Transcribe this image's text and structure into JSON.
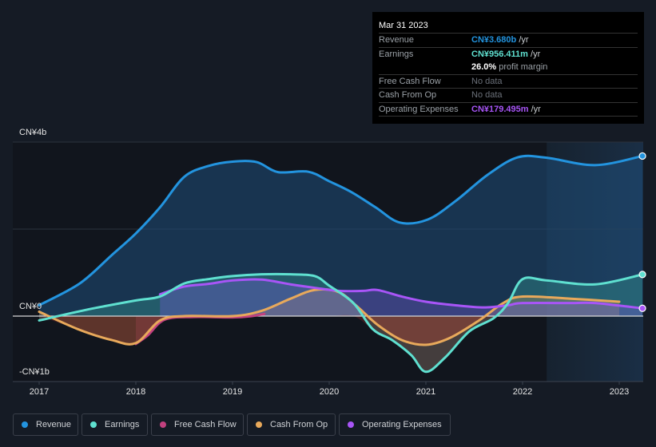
{
  "tooltip": {
    "date": "Mar 31 2023",
    "rows": [
      {
        "label": "Revenue",
        "value": "CN¥3.680b",
        "unit": " /yr",
        "color": "#2394df"
      },
      {
        "label": "Earnings",
        "value": "CN¥956.411m",
        "unit": " /yr",
        "color": "#5fe0d0"
      },
      {
        "label": "",
        "value": "26.0%",
        "unit": " profit margin",
        "color": "#ffffff"
      },
      {
        "label": "Free Cash Flow",
        "value": "No data",
        "unit": "",
        "color": "#6b7079"
      },
      {
        "label": "Cash From Op",
        "value": "No data",
        "unit": "",
        "color": "#6b7079"
      },
      {
        "label": "Operating Expenses",
        "value": "CN¥179.495m",
        "unit": " /yr",
        "color": "#a855f7"
      }
    ]
  },
  "legend": [
    {
      "label": "Revenue",
      "color": "#2394df"
    },
    {
      "label": "Earnings",
      "color": "#5fe0d0"
    },
    {
      "label": "Free Cash Flow",
      "color": "#c2417f"
    },
    {
      "label": "Cash From Op",
      "color": "#e8a95b"
    },
    {
      "label": "Operating Expenses",
      "color": "#a855f7"
    }
  ],
  "chart_data": {
    "type": "line",
    "title": "",
    "xlabel": "",
    "ylabel": "",
    "y_tick_labels": [
      "CN¥4b",
      "CN¥0",
      "-CN¥1b"
    ],
    "y_ticks": [
      4,
      0,
      -1
    ],
    "x_ticks": [
      2017,
      2018,
      2019,
      2020,
      2021,
      2022,
      2023
    ],
    "x_tick_labels": [
      "2017",
      "2018",
      "2019",
      "2020",
      "2021",
      "2022",
      "2023"
    ],
    "xlim": [
      2016.74,
      2023.25
    ],
    "ylim": [
      -1.5,
      4
    ],
    "units": "CN¥ billions",
    "highlight_from": 2022.25,
    "grid": true,
    "legend_position": "bottom",
    "series": [
      {
        "name": "Revenue",
        "color": "#2394df",
        "x": [
          2017.0,
          2017.42,
          2017.75,
          2018.0,
          2018.25,
          2018.5,
          2018.75,
          2019.0,
          2019.25,
          2019.47,
          2019.78,
          2020.0,
          2020.23,
          2020.48,
          2020.73,
          2021.02,
          2021.31,
          2021.64,
          2021.95,
          2022.25,
          2022.75,
          2023.24
        ],
        "y": [
          0.25,
          0.75,
          1.4,
          1.9,
          2.5,
          3.2,
          3.45,
          3.55,
          3.54,
          3.31,
          3.32,
          3.1,
          2.85,
          2.5,
          2.15,
          2.22,
          2.65,
          3.25,
          3.65,
          3.64,
          3.47,
          3.68
        ]
      },
      {
        "name": "Earnings",
        "color": "#5fe0d0",
        "x": [
          2017.0,
          2017.5,
          2018.0,
          2018.25,
          2018.5,
          2018.75,
          2019.0,
          2019.3,
          2019.6,
          2019.85,
          2020.0,
          2020.25,
          2020.45,
          2020.65,
          2020.85,
          2021.0,
          2021.2,
          2021.45,
          2021.7,
          2021.85,
          2022.0,
          2022.25,
          2022.75,
          2023.24
        ],
        "y": [
          -0.1,
          0.15,
          0.36,
          0.45,
          0.75,
          0.85,
          0.92,
          0.96,
          0.96,
          0.92,
          0.7,
          0.3,
          -0.3,
          -0.55,
          -0.9,
          -1.28,
          -0.95,
          -0.35,
          -0.05,
          0.3,
          0.85,
          0.82,
          0.73,
          0.956
        ]
      },
      {
        "name": "Free Cash Flow",
        "color": "#c2417f",
        "x": [
          2018.0,
          2018.12,
          2018.3,
          2018.6,
          2019.0,
          2019.2,
          2019.33
        ],
        "y": [
          -0.64,
          -0.45,
          -0.08,
          -0.02,
          -0.03,
          0.0,
          0.05
        ]
      },
      {
        "name": "Cash From Op",
        "color": "#e8a95b",
        "x": [
          2017.0,
          2017.4,
          2017.75,
          2018.0,
          2018.25,
          2018.5,
          2019.0,
          2019.3,
          2019.6,
          2019.85,
          2020.1,
          2020.3,
          2020.5,
          2020.75,
          2021.0,
          2021.25,
          2021.55,
          2021.8,
          2022.0,
          2022.5,
          2023.0
        ],
        "y": [
          0.1,
          -0.3,
          -0.55,
          -0.62,
          -0.1,
          0.0,
          0.0,
          0.12,
          0.4,
          0.6,
          0.55,
          0.2,
          -0.2,
          -0.55,
          -0.66,
          -0.5,
          -0.1,
          0.3,
          0.45,
          0.4,
          0.33
        ]
      },
      {
        "name": "Operating Expenses",
        "color": "#a855f7",
        "x": [
          2018.25,
          2018.5,
          2018.75,
          2019.0,
          2019.3,
          2019.6,
          2019.85,
          2020.1,
          2020.35,
          2020.5,
          2020.75,
          2021.0,
          2021.3,
          2021.6,
          2021.85,
          2022.0,
          2022.5,
          2022.75,
          2023.24
        ],
        "y": [
          0.5,
          0.68,
          0.74,
          0.82,
          0.84,
          0.73,
          0.65,
          0.58,
          0.58,
          0.6,
          0.45,
          0.33,
          0.25,
          0.2,
          0.25,
          0.3,
          0.3,
          0.3,
          0.179
        ]
      }
    ]
  }
}
